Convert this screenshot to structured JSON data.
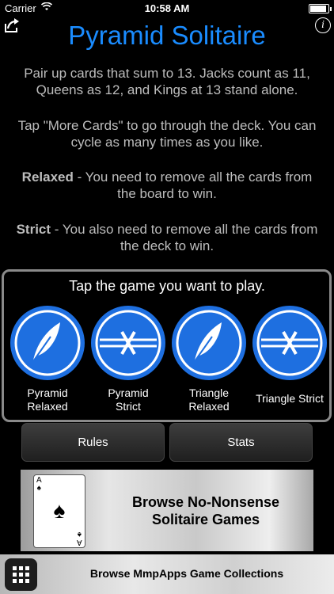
{
  "status_bar": {
    "carrier": "Carrier",
    "time": "10:58 AM",
    "battery_level": 0.9
  },
  "header": {
    "title": "Pyramid Solitaire",
    "info_glyph": "i",
    "share_icon": "share-icon"
  },
  "instructions": {
    "p1": "Pair up cards that sum to 13. Jacks count as 11, Queens as 12, and Kings at 13 stand alone.",
    "p2": "Tap \"More Cards\" to go through the deck. You can cycle as many times as you like.",
    "relaxed_label": "Relaxed",
    "relaxed_text": " - You need to remove all the cards from the board to win.",
    "strict_label": "Strict",
    "strict_text": " - You also need to remove all the cards from the deck to win."
  },
  "picker": {
    "caption": "Tap the game you want to play.",
    "games": [
      {
        "label_line1": "Pyramid",
        "label_line2": "Relaxed",
        "icon": "feather-icon"
      },
      {
        "label_line1": "Pyramid",
        "label_line2": "Strict",
        "icon": "barbed-wire-icon"
      },
      {
        "label_line1": "Triangle",
        "label_line2": "Relaxed",
        "icon": "feather-icon"
      },
      {
        "label_line1": "Triangle Strict",
        "label_line2": "",
        "icon": "barbed-wire-icon"
      }
    ]
  },
  "buttons": {
    "rules": "Rules",
    "stats": "Stats"
  },
  "browse": {
    "line1": "Browse No-Nonsense",
    "line2": "Solitaire Games",
    "card_rank": "A",
    "card_suit": "♠"
  },
  "collections": {
    "label": "Browse MmpApps Game Collections"
  },
  "colors": {
    "accent": "#1a8cff",
    "icon_blue": "#1e6fe0",
    "text_gray": "#bdbdbd"
  }
}
